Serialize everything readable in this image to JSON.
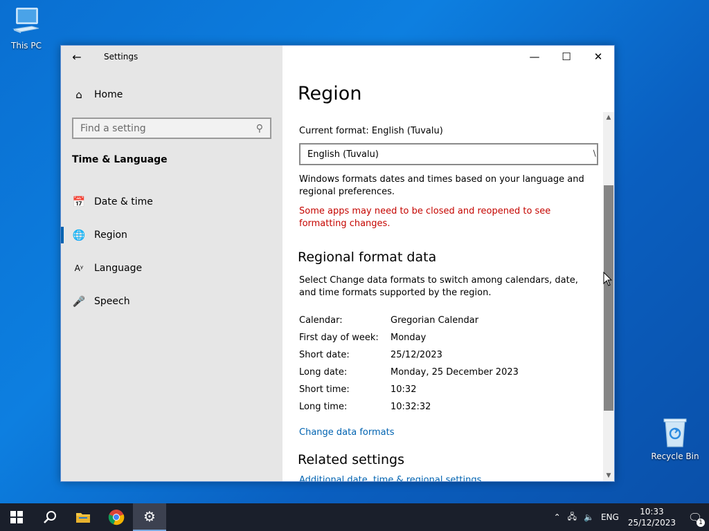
{
  "desktop": {
    "this_pc_label": "This PC",
    "recycle_label": "Recycle Bin"
  },
  "window": {
    "app_title": "Settings",
    "back_icon": "back-arrow-icon"
  },
  "nav": {
    "home_label": "Home",
    "search_placeholder": "Find a setting",
    "section_title": "Time & Language",
    "items": [
      {
        "label": "Date & time",
        "icon": "calendar-clock-icon",
        "active": false
      },
      {
        "label": "Region",
        "icon": "globe-icon",
        "active": true
      },
      {
        "label": "Language",
        "icon": "language-icon",
        "active": false
      },
      {
        "label": "Speech",
        "icon": "microphone-icon",
        "active": false
      }
    ]
  },
  "content": {
    "page_title": "Region",
    "current_format_label": "Current format: English (Tuvalu)",
    "format_value": "English (Tuvalu)",
    "description": "Windows formats dates and times based on your language and regional preferences.",
    "warning": "Some apps may need to be closed and reopened to see formatting changes.",
    "regional_heading": "Regional format data",
    "regional_description": "Select Change data formats to switch among calendars, date, and time formats supported by the region.",
    "format_data": [
      {
        "key": "Calendar:",
        "value": "Gregorian Calendar"
      },
      {
        "key": "First day of week:",
        "value": "Monday"
      },
      {
        "key": "Short date:",
        "value": "25/12/2023"
      },
      {
        "key": "Long date:",
        "value": "Monday, 25 December 2023"
      },
      {
        "key": "Short time:",
        "value": "10:32"
      },
      {
        "key": "Long time:",
        "value": "10:32:32"
      }
    ],
    "change_link": "Change data formats",
    "related_heading": "Related settings",
    "related_link": "Additional date, time & regional settings"
  },
  "taskbar": {
    "language": "ENG",
    "time": "10:33",
    "date": "25/12/2023",
    "notification_count": "1"
  },
  "colors": {
    "accent": "#0063b1",
    "warning": "#c50500",
    "nav_bg": "#e6e6e6"
  }
}
